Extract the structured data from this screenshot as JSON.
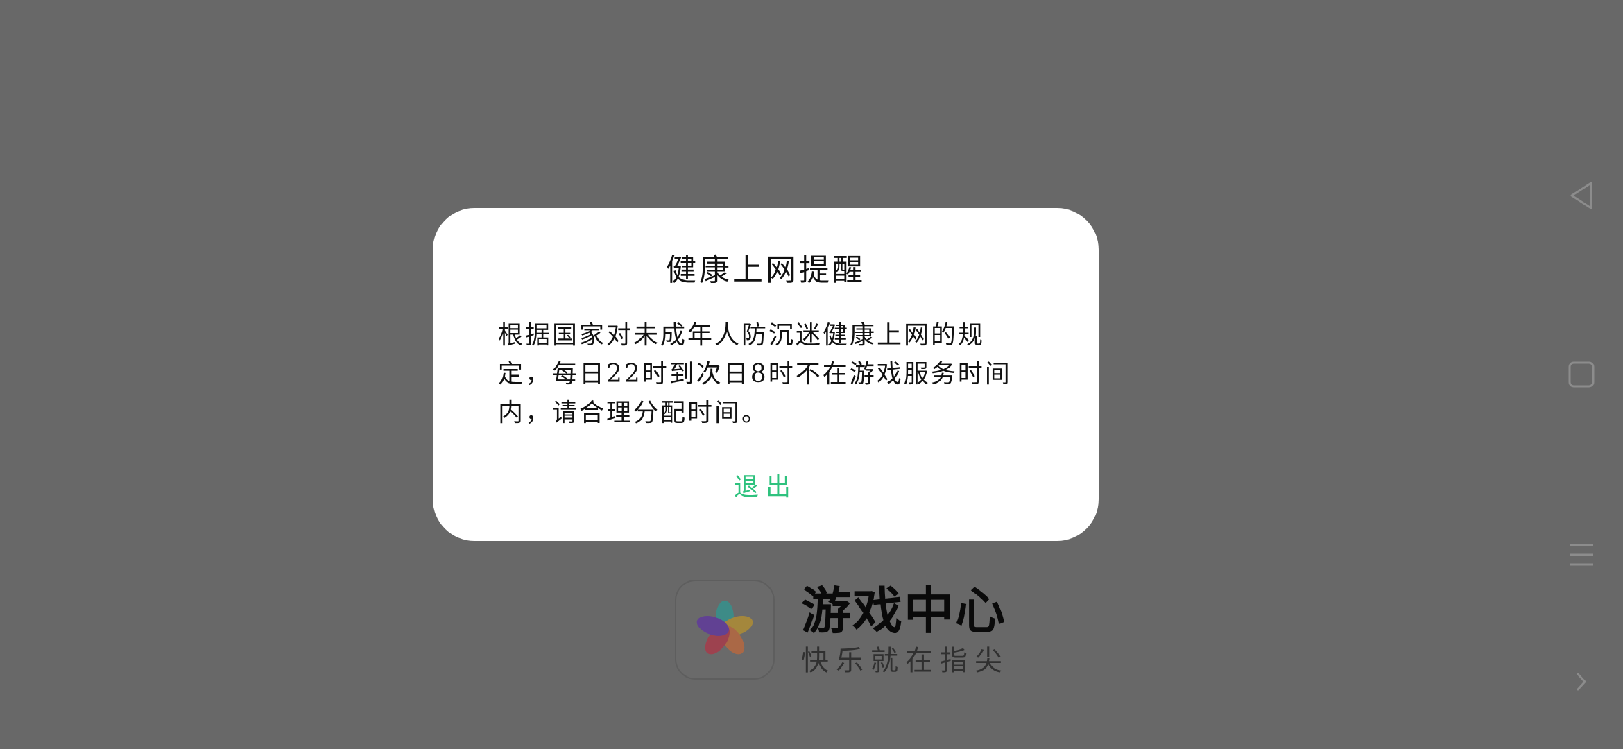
{
  "dialog": {
    "title": "健康上网提醒",
    "message": "根据国家对未成年人防沉迷健康上网的规定，每日22时到次日8时不在游戏服务时间内，请合理分配时间。",
    "exit_label": "退出",
    "accent_color": "#2ec27e"
  },
  "splash": {
    "app_name": "游戏中心",
    "slogan": "快乐就在指尖",
    "logo_icon": "colorful-star-logo-icon"
  },
  "nav": {
    "icons": [
      "back-triangle-icon",
      "home-square-icon",
      "menu-lines-icon",
      "chevron-right-icon"
    ]
  },
  "colors": {
    "overlay_background": "#686868",
    "dialog_background": "#ffffff"
  }
}
